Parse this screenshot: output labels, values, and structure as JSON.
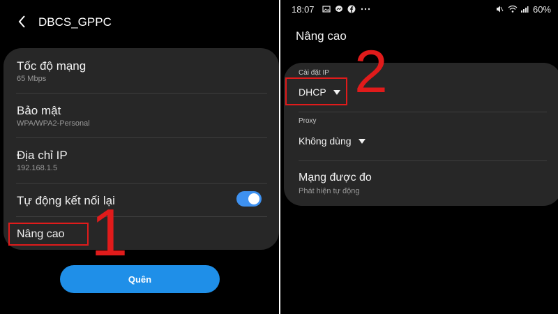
{
  "left": {
    "header": {
      "back_icon": "chevron-left-icon",
      "title": "DBCS_GPPC"
    },
    "settings": [
      {
        "title": "Tốc độ mạng",
        "subtitle": "65 Mbps"
      },
      {
        "title": "Bảo mật",
        "subtitle": "WPA/WPA2-Personal"
      },
      {
        "title": "Địa chỉ IP",
        "subtitle": "192.168.1.5"
      }
    ],
    "auto_reconnect": {
      "label": "Tự động kết nối lại",
      "enabled": true
    },
    "advanced_label": "Nâng cao",
    "forget_button": "Quên",
    "step_number": "1"
  },
  "right": {
    "statusbar": {
      "time": "18:07",
      "left_icons": [
        "image-icon",
        "messenger-icon",
        "facebook-icon",
        "more-icon"
      ],
      "right_icons": [
        "mute-icon",
        "wifi-icon",
        "signal-icon"
      ],
      "battery": "60%"
    },
    "title": "Nâng cao",
    "ip_settings": {
      "label": "Cài đặt IP",
      "value": "DHCP"
    },
    "proxy": {
      "label": "Proxy",
      "value": "Không dùng"
    },
    "metered": {
      "title": "Mạng được đo",
      "subtitle": "Phát hiện tự động"
    },
    "step_number": "2"
  },
  "colors": {
    "accent_blue": "#1f8fe8",
    "toggle_blue": "#3e91f0",
    "annotation_red": "#e01b1b",
    "card_bg": "#272727"
  }
}
